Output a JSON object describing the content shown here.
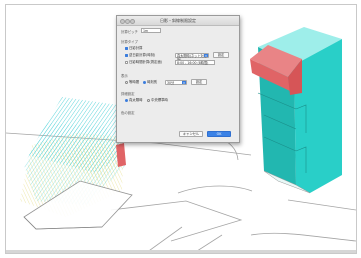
{
  "dialog": {
    "title": "日影・斜線制限設定",
    "field1_label": "計算ピッチ",
    "field1_value": "1m",
    "section1_label": "計算タイプ",
    "opt1": "日影計算",
    "opt2": "逆日影計算(時刻)",
    "opt3": "日影時間計算(測定面)",
    "dropdown_value": "真太陽時(ネット対応版)",
    "set_button": "設定",
    "time_value": "8:00 - 16:00 (8時間)",
    "section2_label": "表示",
    "radio_a": "等時間",
    "radio_b": "時刻別",
    "small_select": "30分",
    "display_button": "設定",
    "section3_label": "詳細設定",
    "radio_c": "真太陽時",
    "radio_d": "中央標準時",
    "section4_label": "色の設定",
    "cancel_label": "キャンセル",
    "ok_label": "OK"
  },
  "colors": {
    "building_front": "#22b7b0",
    "building_side": "#29cfc8",
    "building_top": "#9eeeea",
    "building_red": "#e06466",
    "mesh_cyan": "#47cfd6",
    "mesh_yellow": "#e8e08a",
    "site_lines": "#9a9a9a"
  }
}
